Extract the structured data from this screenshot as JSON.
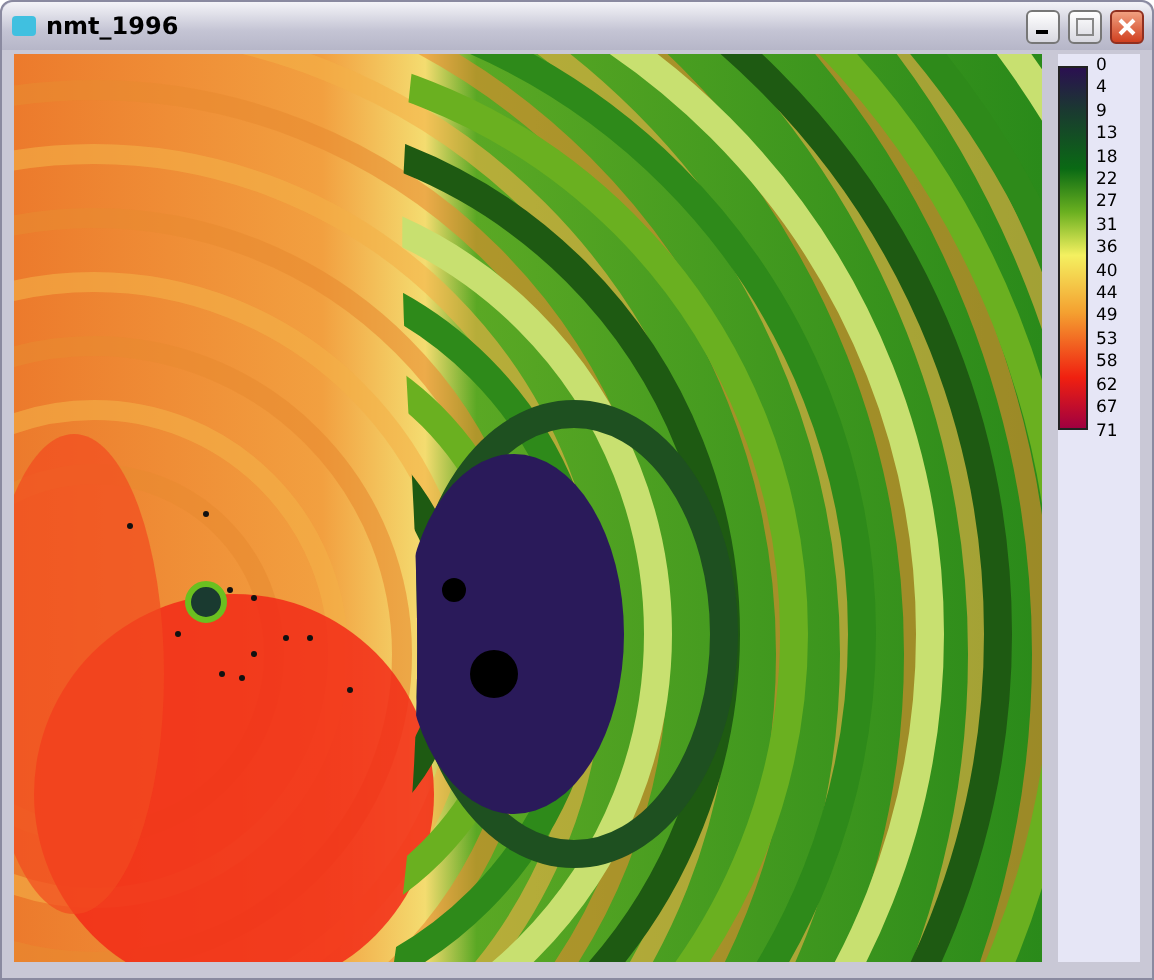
{
  "window": {
    "title": "nmt_1996"
  },
  "legend": {
    "labels": [
      "0",
      "4",
      "9",
      "13",
      "18",
      "22",
      "27",
      "31",
      "36",
      "40",
      "44",
      "49",
      "53",
      "58",
      "62",
      "67",
      "71"
    ]
  }
}
